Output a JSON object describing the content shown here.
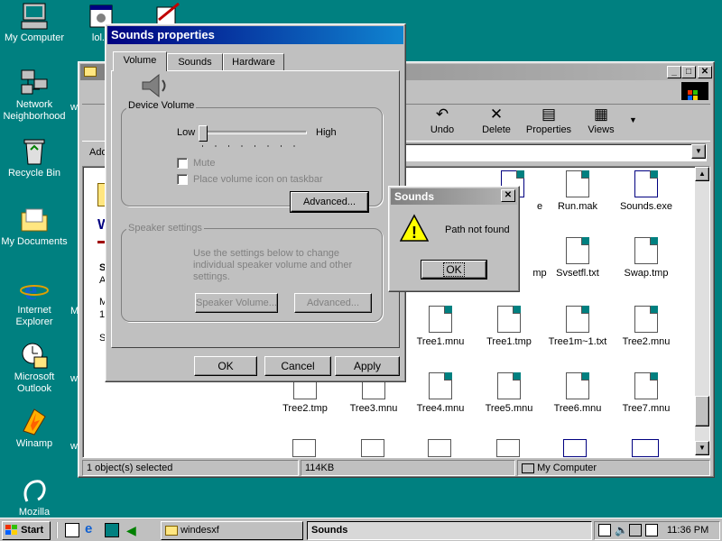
{
  "desktop": {
    "icons": [
      {
        "label": "My Computer"
      },
      {
        "label": "Network Neighborhood"
      },
      {
        "label": "Recycle Bin"
      },
      {
        "label": "My Documents"
      },
      {
        "label": "Internet Explorer"
      },
      {
        "label": "Microsoft Outlook"
      },
      {
        "label": "Winamp"
      },
      {
        "label": "Mozilla"
      },
      {
        "label": "lol.b"
      }
    ]
  },
  "explorer": {
    "toolbar": [
      "Undo",
      "Delete",
      "Properties",
      "Views"
    ],
    "address_label": "Add",
    "side_letter_1": "S",
    "side_letter_2": "A",
    "side_letter_3": "M",
    "side_letter_4": "1,",
    "side_letter_5": "S",
    "side_char_6": "W",
    "files": [
      {
        "name": "e"
      },
      {
        "name": "Run.mak"
      },
      {
        "name": "Sounds.exe"
      },
      {
        "name": "mp"
      },
      {
        "name": "Svsetfl.txt"
      },
      {
        "name": "Swap.tmp"
      },
      {
        "name": "Tree1.mnu"
      },
      {
        "name": "Tree1.tmp"
      },
      {
        "name": "Tree1m~1.txt"
      },
      {
        "name": "Tree2.mnu"
      },
      {
        "name": "Tree2.tmp"
      },
      {
        "name": "Tree3.mnu"
      },
      {
        "name": "Tree4.mnu"
      },
      {
        "name": "Tree5.mnu"
      },
      {
        "name": "Tree6.mnu"
      },
      {
        "name": "Tree7.mnu"
      }
    ],
    "status": {
      "selected": "1 object(s) selected",
      "size": "114KB",
      "zone": "My Computer"
    },
    "left_labels": [
      "w",
      "M",
      "w",
      "w"
    ]
  },
  "props": {
    "title": "Sounds properties",
    "tabs": [
      "Volume",
      "Sounds",
      "Hardware"
    ],
    "device_volume_label": "Device Volume",
    "low": "Low",
    "high": "High",
    "mute": "Mute",
    "place_icon": "Place volume icon on taskbar",
    "advanced": "Advanced...",
    "speaker_settings": "Speaker settings",
    "speaker_desc": "Use the settings below to change individual speaker volume and other settings.",
    "speaker_volume": "Speaker Volume...",
    "advanced2": "Advanced...",
    "ok": "OK",
    "cancel": "Cancel",
    "apply": "Apply",
    "volume_level": 0
  },
  "msgbox": {
    "title": "Sounds",
    "message": "Path not found",
    "ok": "OK"
  },
  "taskbar": {
    "start": "Start",
    "tasks": [
      "windesxf",
      "Sounds"
    ],
    "clock": "11:36 PM"
  },
  "colors": {
    "desktop": "#008080",
    "active_title": "#000080",
    "inactive_title": "#808080"
  }
}
